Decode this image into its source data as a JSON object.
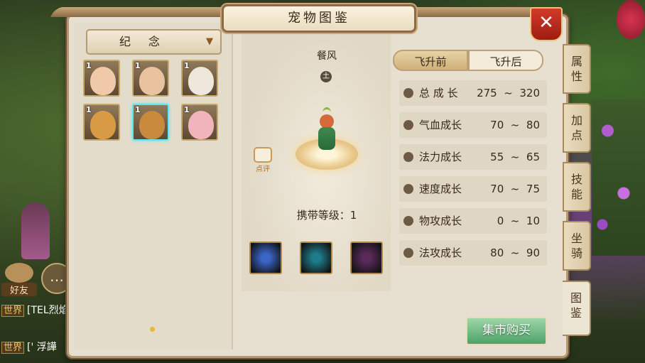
{
  "window": {
    "title": "宠物图鉴",
    "close_icon": "close-icon"
  },
  "filter": {
    "selected": "纪 念"
  },
  "pets": [
    {
      "level": "1",
      "icon": "girl-portrait",
      "color": "#f0c9a8"
    },
    {
      "level": "1",
      "icon": "boy-portrait",
      "color": "#e9c3a0"
    },
    {
      "level": "1",
      "icon": "siamese-cat",
      "color": "#efe6dc"
    },
    {
      "level": "1",
      "icon": "tabby-cat",
      "color": "#d99a45"
    },
    {
      "level": "1",
      "icon": "squirrel",
      "color": "#c98a3e"
    },
    {
      "level": "1",
      "icon": "pink-deer",
      "color": "#f1b4bd"
    }
  ],
  "detail": {
    "name": "餐风",
    "element": "土",
    "comment_label": "点评",
    "carry_level": "携带等级：1",
    "skills": [
      {
        "icon": "claw-slash-skill",
        "color": "#3a64c6"
      },
      {
        "icon": "ring-orb-skill",
        "color": "#1e7b8a"
      },
      {
        "icon": "spiked-ball-skill",
        "color": "#5a2a5a"
      }
    ]
  },
  "growth_tabs": [
    {
      "label": "飞升前",
      "active": true
    },
    {
      "label": "飞升后",
      "active": false
    }
  ],
  "stats": [
    {
      "icon": "total-growth-icon",
      "label": "总 成 长",
      "value": "275  ~  320"
    },
    {
      "icon": "hp-growth-icon",
      "label": "气血成长",
      "value": "70  ~  80"
    },
    {
      "icon": "mana-growth-icon",
      "label": "法力成长",
      "value": "55  ~  65"
    },
    {
      "icon": "speed-growth-icon",
      "label": "速度成长",
      "value": "70  ~  75"
    },
    {
      "icon": "physical-attack-icon",
      "label": "物攻成长",
      "value": "0  ~  10"
    },
    {
      "icon": "magic-attack-icon",
      "label": "法攻成长",
      "value": "80  ~  90"
    }
  ],
  "side_tabs": [
    {
      "label": "属\n性"
    },
    {
      "label": "加\n点"
    },
    {
      "label": "技\n能"
    },
    {
      "label": "坐\n骑"
    },
    {
      "label": "图\n鉴"
    }
  ],
  "buy_button": "集市购买",
  "hud": {
    "friends_label": "好友",
    "chat": [
      {
        "channel": "世界",
        "text": "[TEL烈焰"
      },
      {
        "channel": "世界",
        "text": "[' 浮譁"
      }
    ]
  }
}
